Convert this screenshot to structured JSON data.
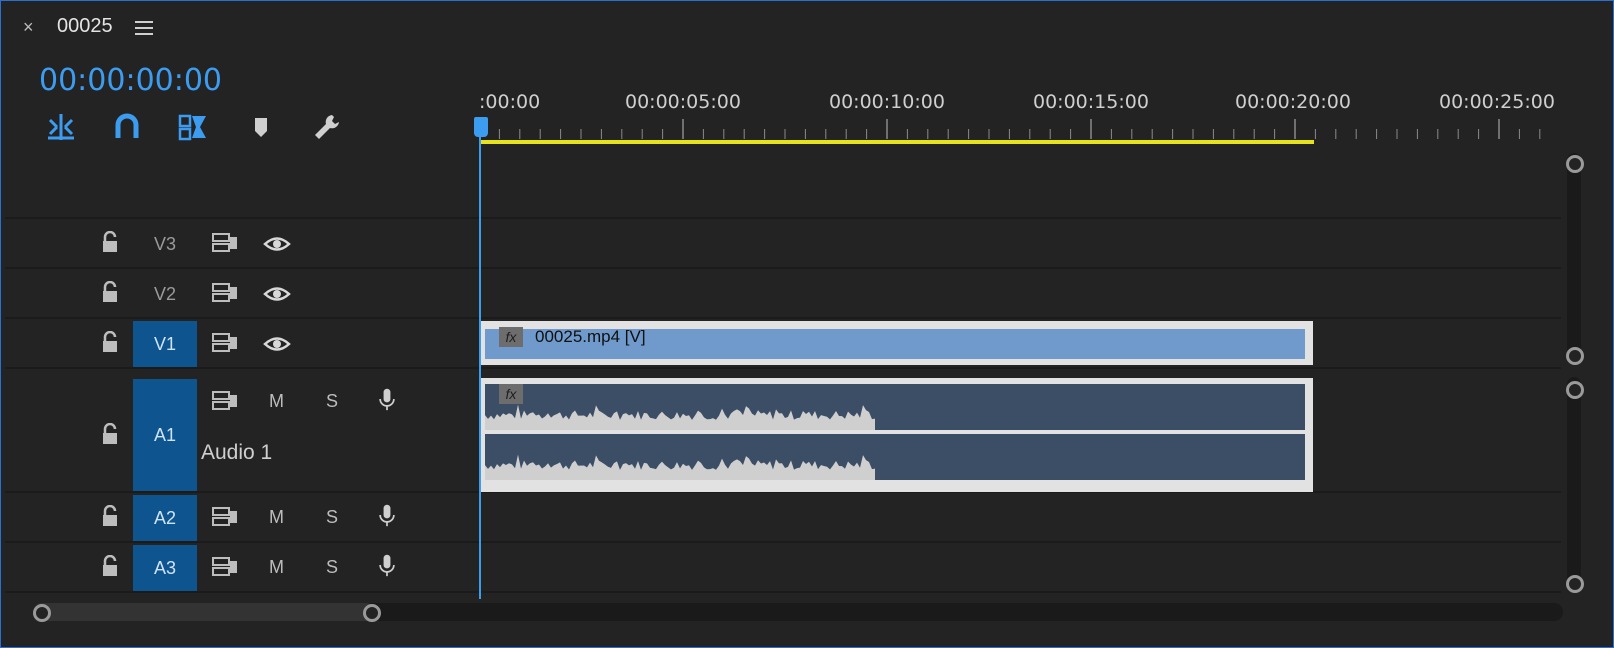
{
  "header": {
    "close_glyph": "×",
    "title": "00025",
    "menu_icon": "hamburger-icon"
  },
  "timecode": "00:00:00:00",
  "tools": [
    {
      "name": "insert-overwrite-icon",
      "color": "#3c9cf0"
    },
    {
      "name": "snap-magnet-icon",
      "color": "#3c9cf0"
    },
    {
      "name": "linked-selection-icon",
      "color": "#3c9cf0"
    },
    {
      "name": "add-marker-icon",
      "color": "#cfcfcf"
    },
    {
      "name": "wrench-settings-icon",
      "color": "#cfcfcf"
    }
  ],
  "ruler": {
    "labels": [
      ":00:00",
      "00:00:05:00",
      "00:00:10:00",
      "00:00:15:00",
      "00:00:20:00",
      "00:00:25:00"
    ]
  },
  "tracks": {
    "video": [
      {
        "label": "V3",
        "active": false
      },
      {
        "label": "V2",
        "active": false
      },
      {
        "label": "V1",
        "active": true
      }
    ],
    "audio": [
      {
        "label": "A1",
        "active": true,
        "name": "Audio 1",
        "mute": "M",
        "solo": "S"
      },
      {
        "label": "A2",
        "active": true,
        "mute": "M",
        "solo": "S"
      },
      {
        "label": "A3",
        "active": true,
        "mute": "M",
        "solo": "S"
      }
    ]
  },
  "clips": {
    "video": {
      "name": "00025.mp4 [V]",
      "fx": "fx"
    },
    "audio": {
      "fx": "fx"
    }
  },
  "colors": {
    "accent": "#3c9cf0",
    "work_area": "#e6e21c",
    "video_clip": "#6f9acb",
    "audio_clip": "#3c4d66",
    "track_label_active": "#0e5590"
  }
}
